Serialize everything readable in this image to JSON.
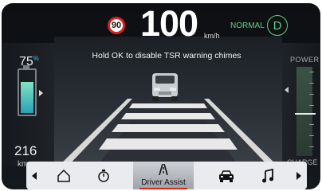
{
  "header": {
    "speed_limit": "90",
    "speed": "100",
    "speed_unit": "km/h",
    "drive_mode": "NORMAL",
    "gear": "D"
  },
  "message": "Hold OK to disable TSR warning chimes",
  "battery": {
    "percent": "75",
    "percent_symbol": "%",
    "level": 0.75,
    "range_value": "216",
    "range_unit": "km"
  },
  "power_gauge": {
    "power_label": "POWER",
    "charge_label": "CHARGE"
  },
  "nav": {
    "items": [
      {
        "icon": "chevron-left-icon"
      },
      {
        "icon": "home-icon"
      },
      {
        "icon": "stopwatch-icon"
      },
      {
        "icon": "driver-assist-icon",
        "label": "Driver Assist",
        "active": true
      },
      {
        "icon": "car-icon"
      },
      {
        "icon": "music-note-icon"
      },
      {
        "icon": "chevron-right-icon"
      }
    ]
  },
  "colors": {
    "accent_green": "#5fd08a",
    "alert_red": "#dd2222",
    "battery_fill": "#2aa3b7"
  }
}
